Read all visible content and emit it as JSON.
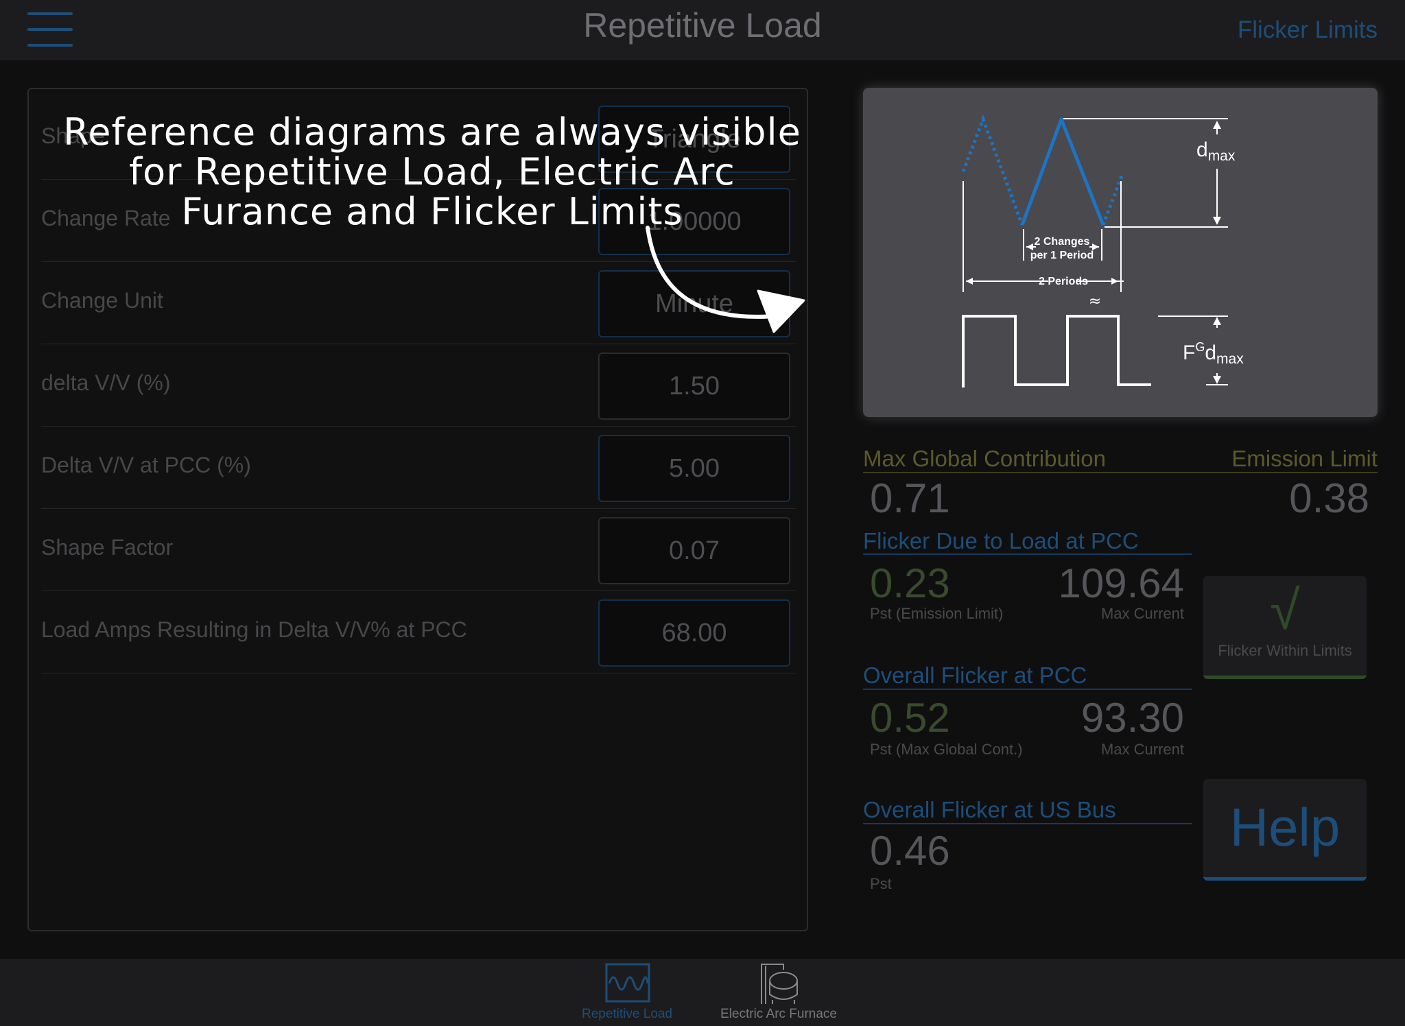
{
  "nav": {
    "title": "Repetitive Load",
    "right_button": "Flicker Limits"
  },
  "form": {
    "rows": [
      {
        "label": "Shape",
        "value": "Triangle"
      },
      {
        "label": "Change Rate",
        "value": "1.00000"
      },
      {
        "label": "Change Unit",
        "value": "Minute"
      },
      {
        "label": "delta V/V (%)",
        "value": "1.50"
      },
      {
        "label": "Delta V/V at PCC (%)",
        "value": "5.00"
      },
      {
        "label": "Shape Factor",
        "value": "0.07"
      },
      {
        "label": "Load Amps Resulting in Delta V/V% at PCC",
        "value": "68.00"
      }
    ]
  },
  "annotation": {
    "line1": "Reference diagrams are always visible",
    "line2": "for Repetitive Load, Electric Arc",
    "line3": "Furance and Flicker Limits"
  },
  "diagram": {
    "dmax_main": "d",
    "dmax_sub": "max",
    "changes_line1": "2 Changes",
    "changes_line2": "per 1 Period",
    "periods": "2 Periods",
    "approx": "≈",
    "fg_f": "F",
    "fg_sup": "G",
    "fg_d": "d",
    "fg_sub": "max"
  },
  "results": {
    "max_global_label": "Max Global Contribution",
    "emission_limit_label": "Emission Limit",
    "max_global_value": "0.71",
    "emission_limit_value": "0.38",
    "load_pcc": {
      "title": "Flicker Due to Load at PCC",
      "pst_value": "0.23",
      "pst_label": "Pst (Emission Limit)",
      "current_value": "109.64",
      "current_label": "Max Current"
    },
    "overall_pcc": {
      "title": "Overall Flicker at PCC",
      "pst_value": "0.52",
      "pst_label": "Pst (Max Global Cont.)",
      "current_value": "93.30",
      "current_label": "Max Current"
    },
    "us_bus": {
      "title": "Overall Flicker at US Bus",
      "pst_value": "0.46",
      "pst_label": "Pst"
    },
    "status_check": "√",
    "status_label": "Flicker Within Limits",
    "help_label": "Help"
  },
  "tabs": [
    {
      "label": "Repetitive Load",
      "icon": "waveform-icon",
      "active": true
    },
    {
      "label": "Electric Arc Furnace",
      "icon": "furnace-icon",
      "active": false
    }
  ],
  "colors": {
    "accent_blue": "#1d4e7a",
    "olive": "#5a5a2a",
    "green": "#2e4a27",
    "diagram_wave": "#1e74c4"
  }
}
